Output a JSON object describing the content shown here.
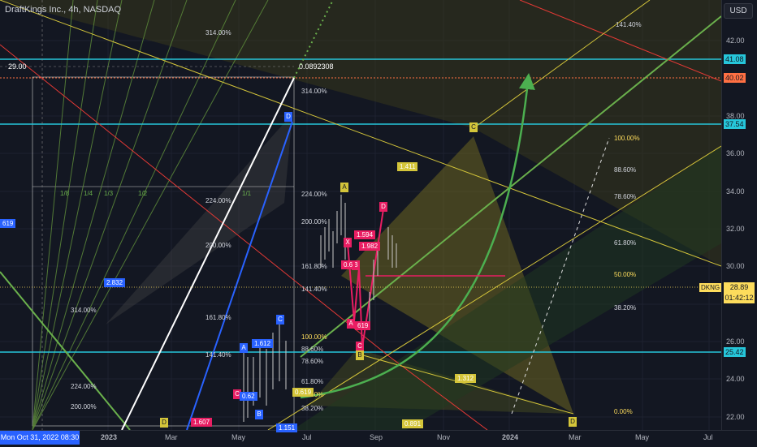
{
  "header": {
    "symbol_line": "DraftKings Inc., 4h, NASDAQ",
    "currency_label": "USD"
  },
  "crosshair": {
    "date_label": "Mon Oct 31, 2022 08:30",
    "price_label": "29.00",
    "ray_value": "0.0892308"
  },
  "x_axis": {
    "ticks": [
      "2023",
      "Mar",
      "May",
      "Jul",
      "Sep",
      "Nov",
      "2024",
      "Mar",
      "May",
      "Jul"
    ]
  },
  "y_axis": {
    "ticks": [
      "42.00",
      "38.00",
      "36.00",
      "34.00",
      "32.00",
      "30.00",
      "28.00",
      "26.00",
      "24.00",
      "22.00"
    ]
  },
  "price_tags": {
    "level_41": "41.08",
    "level_40": "40.02",
    "level_37": "37.54",
    "level_25": "25.42",
    "last_price": "28.89",
    "countdown": "01:42:12",
    "ticker": "DKNG"
  },
  "fib_labels_right": [
    "141.40%",
    "100.00%",
    "88.60%",
    "78.60%",
    "61.80%",
    "50.00%",
    "38.20%",
    "0.00%"
  ],
  "fib_labels_mid": [
    "314.00%",
    "224.00%",
    "200.00%",
    "161.80%",
    "141.40%",
    "100.00%",
    "88.60%",
    "78.60%",
    "61.80%",
    "50.00%",
    "38.20%"
  ],
  "fib_labels_left": [
    "314.00%",
    "224.00%",
    "200.00%",
    "161.80%",
    "141.40%",
    "314.00%",
    "224.00%",
    "200.00%"
  ],
  "fan_labels": [
    "1/8",
    "1/4",
    "1/3",
    "1/2",
    "1/1"
  ],
  "pattern_points": [
    "A",
    "B",
    "C",
    "D",
    "X",
    "A",
    "B",
    "C",
    "D",
    "C",
    "D",
    "A",
    "B",
    "C",
    "D"
  ],
  "ratio_labels": [
    "1.411",
    "2.832",
    "1.612",
    "1.594",
    "1.982",
    "1.312",
    "0.619",
    "0.62",
    "1.607",
    "0.6",
    "619",
    "0.891",
    "1.151",
    "619"
  ],
  "colors": {
    "background": "#131722",
    "cyan_level": "#26c6da",
    "yellow_pattern": "#d4c53a",
    "pink_pattern": "#e91e63",
    "blue_pattern": "#2962ff",
    "green_arrow": "#4caf50",
    "orange_level": "#ff7043",
    "red_line": "#e53935"
  },
  "chart_data": {
    "type": "candlestick",
    "title": "DraftKings Inc., 4h, NASDAQ",
    "ylim": [
      21.5,
      43.0
    ],
    "y_unit": "USD",
    "horizontal_levels": [
      41.08,
      40.02,
      37.54,
      25.42,
      28.89
    ],
    "last_price": 28.89,
    "harmonic_patterns": [
      {
        "name": "large-yellow",
        "points": {
          "A": 34.0,
          "C": 37.54,
          "D": 22.0,
          "B": 25.5
        }
      },
      {
        "name": "pink",
        "points": {
          "X": 31.5,
          "A": 27.0,
          "B": 31.0,
          "C": 25.8,
          "D": 33.0
        }
      }
    ],
    "grid": true
  }
}
